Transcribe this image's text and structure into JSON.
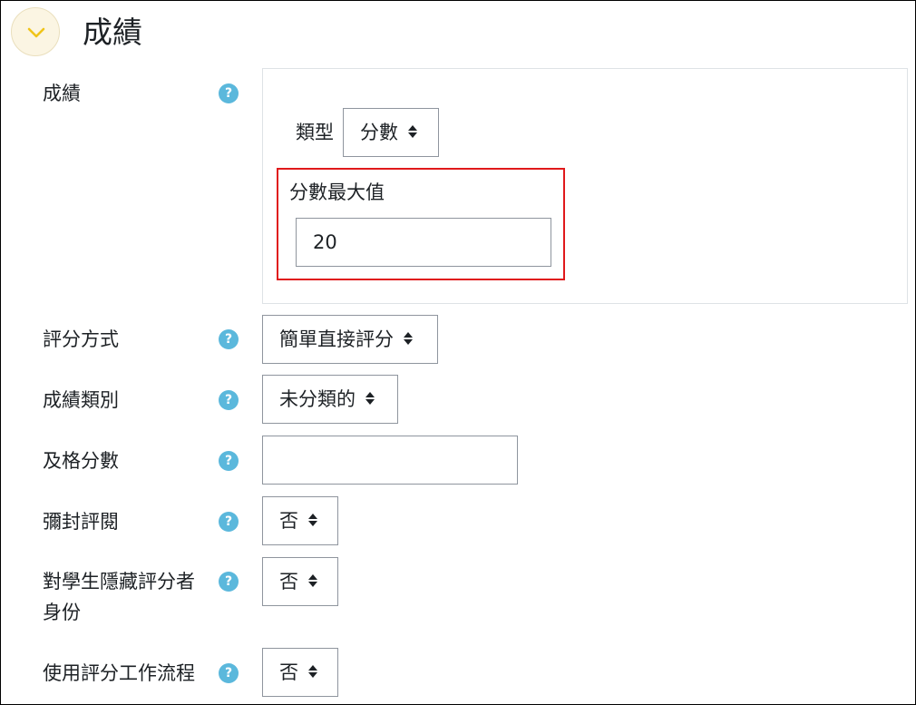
{
  "section": {
    "title": "成績"
  },
  "grade": {
    "label": "成績",
    "type_label": "類型",
    "type_value": "分數",
    "max_label": "分數最大值",
    "max_value": "20"
  },
  "fields": {
    "grading_method": {
      "label": "評分方式",
      "value": "簡單直接評分"
    },
    "grade_category": {
      "label": "成績類別",
      "value": "未分類的"
    },
    "pass_grade": {
      "label": "及格分數",
      "value": ""
    },
    "blind_marking": {
      "label": "彌封評閱",
      "value": "否"
    },
    "hide_grader": {
      "label_line1": "對學生隱藏評分者",
      "label_line2": "身份",
      "value": "否"
    },
    "marking_workflow": {
      "label": "使用評分工作流程",
      "value": "否"
    }
  },
  "help_icon": "?",
  "colors": {
    "help": "#5bb8dc",
    "highlight": "#e0191b",
    "collapse_bg": "#fbf5e3",
    "collapse_icon": "#f0c419"
  }
}
